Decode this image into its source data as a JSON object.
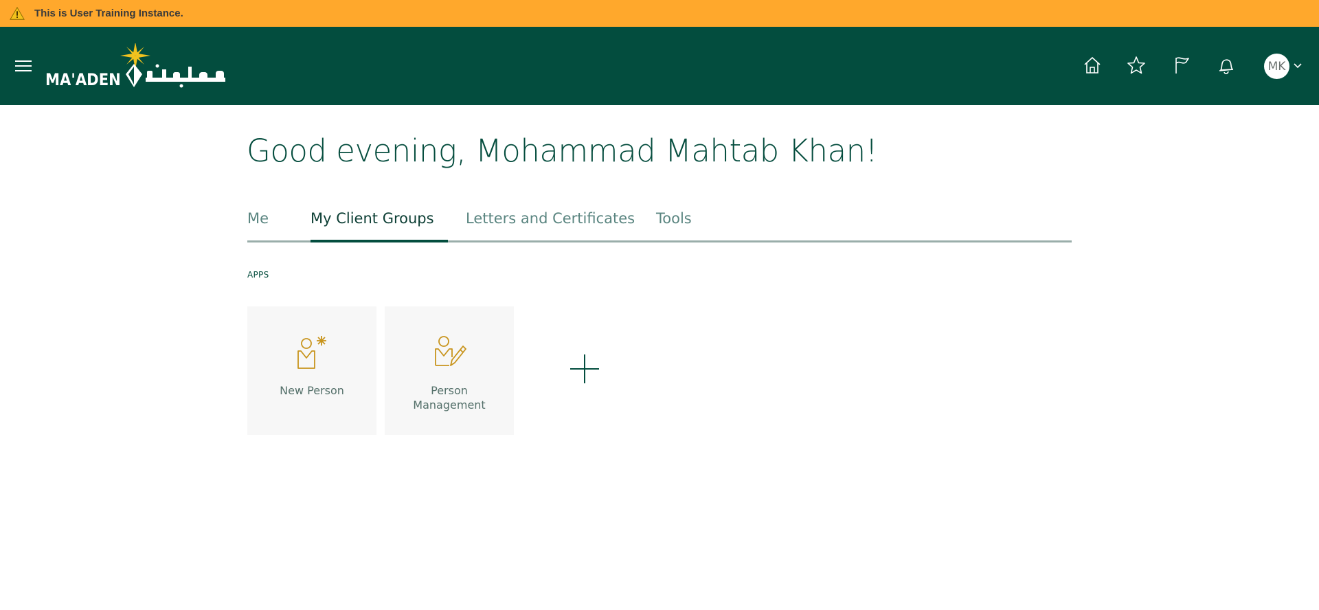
{
  "banner": {
    "message": "This is User Training Instance.",
    "icon": "warning-triangle-icon",
    "color": "#ffa82c"
  },
  "header": {
    "background": "#034d3e",
    "logo_text": "MA'ADEN",
    "logo_text_arabic": "معادن",
    "icons": [
      "home-icon",
      "star-icon",
      "flag-icon",
      "bell-icon"
    ],
    "avatar_initials": "MK"
  },
  "main": {
    "greeting": "Good evening, Mohammad Mahtab Khan!",
    "tabs": [
      {
        "label": "Me",
        "active": false
      },
      {
        "label": "My Client Groups",
        "active": true
      },
      {
        "label": "Letters and Certificates",
        "active": false
      },
      {
        "label": "Tools",
        "active": false
      }
    ],
    "section_label": "APPS",
    "apps": [
      {
        "label": "New Person",
        "icon": "new-person-icon"
      },
      {
        "label": "Person Management",
        "icon": "person-management-icon"
      }
    ],
    "add_icon": "plus-icon"
  },
  "colors": {
    "accent": "#034d3e",
    "icon_gold": "#c8941c",
    "tile_bg": "#f7f7f7"
  }
}
